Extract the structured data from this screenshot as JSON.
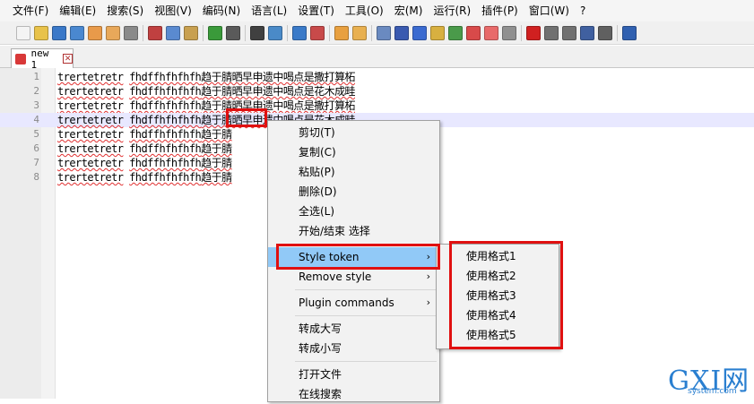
{
  "menubar": [
    "文件(F)",
    "编辑(E)",
    "搜索(S)",
    "视图(V)",
    "编码(N)",
    "语言(L)",
    "设置(T)",
    "工具(O)",
    "宏(M)",
    "运行(R)",
    "插件(P)",
    "窗口(W)",
    "?"
  ],
  "toolbar_icons": [
    {
      "name": "new-file-icon",
      "color": "#f4f4f4"
    },
    {
      "name": "open-file-icon",
      "color": "#e8c24a"
    },
    {
      "name": "save-icon",
      "color": "#3a78c8"
    },
    {
      "name": "save-all-icon",
      "color": "#4a88d0"
    },
    {
      "name": "close-icon",
      "color": "#e89a4a"
    },
    {
      "name": "close-all-icon",
      "color": "#e8a85a"
    },
    {
      "name": "print-icon",
      "color": "#8a8a8a"
    },
    {
      "name": "sep"
    },
    {
      "name": "cut-icon",
      "color": "#c04040"
    },
    {
      "name": "copy-icon",
      "color": "#5a8ad0"
    },
    {
      "name": "paste-icon",
      "color": "#c8a050"
    },
    {
      "name": "sep"
    },
    {
      "name": "undo-icon",
      "color": "#3a9a3a"
    },
    {
      "name": "redo-icon",
      "color": "#5a5a5a"
    },
    {
      "name": "sep"
    },
    {
      "name": "find-icon",
      "color": "#404040"
    },
    {
      "name": "replace-icon",
      "color": "#4a8ac8"
    },
    {
      "name": "sep"
    },
    {
      "name": "zoom-in-icon",
      "color": "#3a7ac8"
    },
    {
      "name": "zoom-out-icon",
      "color": "#c84a4a"
    },
    {
      "name": "sep"
    },
    {
      "name": "sync-vertical-icon",
      "color": "#e8a040"
    },
    {
      "name": "sync-horizontal-icon",
      "color": "#e8b050"
    },
    {
      "name": "sep"
    },
    {
      "name": "word-wrap-icon",
      "color": "#6a8ac0"
    },
    {
      "name": "show-all-chars-icon",
      "color": "#3a5ab0"
    },
    {
      "name": "indent-guide-icon",
      "color": "#3a6ad0"
    },
    {
      "name": "doc-map-icon",
      "color": "#d8b040"
    },
    {
      "name": "function-list-icon",
      "color": "#4a9a4a"
    },
    {
      "name": "folder-workspace-icon",
      "color": "#d84a4a"
    },
    {
      "name": "monitor-icon",
      "color": "#e86a6a"
    },
    {
      "name": "bubble-icon",
      "color": "#909090"
    },
    {
      "name": "sep"
    },
    {
      "name": "record-macro-icon",
      "color": "#d02020"
    },
    {
      "name": "stop-record-icon",
      "color": "#707070"
    },
    {
      "name": "play-macro-icon",
      "color": "#707070"
    },
    {
      "name": "run-macro-multiple-icon",
      "color": "#4060a0"
    },
    {
      "name": "save-macro-icon",
      "color": "#606060"
    },
    {
      "name": "sep"
    },
    {
      "name": "spell-check-icon",
      "color": "#3060b0"
    }
  ],
  "tab": {
    "label": "new 1"
  },
  "editor": {
    "lines": [
      {
        "num": "1",
        "a": "trertetretr",
        "b": "fhdffhfhfhfh",
        "c": "趋于腈晒早申遗中喝点是撒打算柘"
      },
      {
        "num": "2",
        "a": "trertetretr",
        "b": "fhdffhfhfhfh",
        "c": "趋于腈晒早申遗中喝点是花木成畦"
      },
      {
        "num": "3",
        "a": "trertetretr",
        "b": "fhdffhfhfhfh",
        "c": "趋于腈晒早申遗中喝点是撒打算柘"
      },
      {
        "num": "4",
        "a": "trertetretr",
        "b": "fhdffhfhfhfh",
        "c": "趋于腈晒早申遗中喝点是花木成畦"
      },
      {
        "num": "5",
        "a": "trertetretr",
        "b": "fhdffhfhfhfh",
        "c": "趋于腈"
      },
      {
        "num": "6",
        "a": "trertetretr",
        "b": "fhdffhfhfhfh",
        "c": "趋于腈"
      },
      {
        "num": "7",
        "a": "trertetretr",
        "b": "fhdffhfhfhfh",
        "c": "趋于腈"
      },
      {
        "num": "8",
        "a": "trertetretr",
        "b": "fhdffhfhfhfh",
        "c": "趋于腈"
      }
    ]
  },
  "context_menu": {
    "cut": "剪切(T)",
    "copy": "复制(C)",
    "paste": "粘贴(P)",
    "delete": "删除(D)",
    "select_all": "全选(L)",
    "begin_end_select": "开始/结束 选择",
    "style_token": "Style token",
    "remove_style": "Remove style",
    "plugin_commands": "Plugin commands",
    "to_upper": "转成大写",
    "to_lower": "转成小写",
    "open_file": "打开文件",
    "search_online": "在线搜索",
    "arrow": "›"
  },
  "submenu": [
    "使用格式1",
    "使用格式2",
    "使用格式3",
    "使用格式4",
    "使用格式5"
  ],
  "watermark": {
    "logo": "GXI网",
    "domain": "system.com"
  }
}
